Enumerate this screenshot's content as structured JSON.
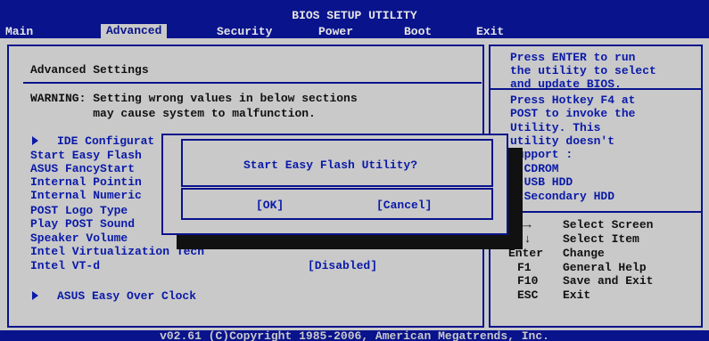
{
  "header": {
    "title": "BIOS SETUP UTILITY",
    "menu": [
      "Main",
      "Advanced",
      "Security",
      "Power",
      "Boot",
      "Exit"
    ],
    "active": "Advanced"
  },
  "main": {
    "section_title": "Advanced Settings",
    "warning_line1": "WARNING: Setting wrong values in below sections",
    "warning_line2": "         may cause system to malfunction.",
    "items": [
      "IDE Configurat",
      "Start Easy Flash",
      "ASUS FancyStart",
      "Internal Pointin",
      "Internal Numeric",
      "POST Logo Type",
      "Play POST Sound",
      "Speaker Volume",
      "Intel Virtualization Tech",
      "Intel VT-d"
    ],
    "vtd_value": "[Disabled]",
    "overclock_item": "ASUS Easy Over Clock"
  },
  "help": {
    "lines": [
      "Press ENTER to run",
      "the utility to select",
      "and update BIOS.",
      "Press Hotkey F4 at",
      "POST to invoke the",
      "Utility. This",
      "utility doesn't",
      "support :",
      "1.CDROM",
      "2.USB HDD",
      "3.Secondary HDD"
    ],
    "keys": [
      {
        "key": "←→",
        "desc": "Select Screen"
      },
      {
        "key": "↑↓",
        "desc": "Select Item"
      },
      {
        "key": "Enter",
        "desc": "Change"
      },
      {
        "key": "F1",
        "desc": "General Help"
      },
      {
        "key": "F10",
        "desc": "Save and Exit"
      },
      {
        "key": "ESC",
        "desc": "Exit"
      }
    ]
  },
  "dialog": {
    "message": "Start Easy Flash Utility?",
    "ok": "[OK]",
    "cancel": "[Cancel]"
  },
  "footer": {
    "copyright": "v02.61 (C)Copyright 1985-2006, American Megatrends, Inc."
  }
}
